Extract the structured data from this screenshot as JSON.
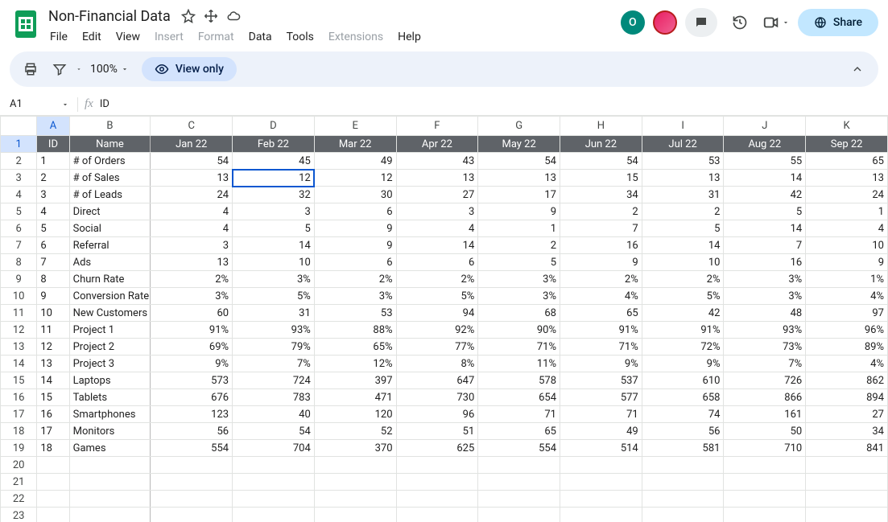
{
  "doc": {
    "title": "Non-Financial Data"
  },
  "menus": {
    "file": "File",
    "edit": "Edit",
    "view": "View",
    "insert": "Insert",
    "format": "Format",
    "data": "Data",
    "tools": "Tools",
    "extensions": "Extensions",
    "help": "Help"
  },
  "header": {
    "share": "Share",
    "avatar_letter": "O"
  },
  "toolbar": {
    "zoom": "100%",
    "viewonly": "View only"
  },
  "formula": {
    "name": "A1",
    "value": "ID"
  },
  "columns": [
    "A",
    "B",
    "C",
    "D",
    "E",
    "F",
    "G",
    "H",
    "I",
    "J",
    "K"
  ],
  "row_numbers": [
    "1",
    "2",
    "3",
    "4",
    "5",
    "6",
    "7",
    "8",
    "9",
    "10",
    "11",
    "12",
    "13",
    "14",
    "15",
    "16",
    "17",
    "18",
    "19",
    "20",
    "21",
    "22",
    "23"
  ],
  "header_row": [
    "ID",
    "Name",
    "Jan 22",
    "Feb 22",
    "Mar 22",
    "Apr 22",
    "May 22",
    "Jun 22",
    "Jul 22",
    "Aug 22",
    "Sep 22"
  ],
  "rows": [
    {
      "id": "1",
      "name": "# of Orders",
      "v": [
        "54",
        "45",
        "49",
        "43",
        "54",
        "54",
        "53",
        "55",
        "65"
      ]
    },
    {
      "id": "2",
      "name": "# of Sales",
      "v": [
        "13",
        "12",
        "12",
        "13",
        "13",
        "15",
        "13",
        "14",
        "13"
      ]
    },
    {
      "id": "3",
      "name": "# of Leads",
      "v": [
        "24",
        "32",
        "30",
        "27",
        "17",
        "34",
        "31",
        "42",
        "24"
      ]
    },
    {
      "id": "4",
      "name": "Direct",
      "v": [
        "4",
        "3",
        "6",
        "3",
        "9",
        "2",
        "2",
        "5",
        "1"
      ]
    },
    {
      "id": "5",
      "name": "Social",
      "v": [
        "4",
        "5",
        "9",
        "4",
        "1",
        "7",
        "5",
        "14",
        "4"
      ]
    },
    {
      "id": "6",
      "name": "Referral",
      "v": [
        "3",
        "14",
        "9",
        "14",
        "2",
        "16",
        "14",
        "7",
        "10"
      ]
    },
    {
      "id": "7",
      "name": "Ads",
      "v": [
        "13",
        "10",
        "6",
        "6",
        "5",
        "9",
        "10",
        "16",
        "9"
      ]
    },
    {
      "id": "8",
      "name": "Churn Rate",
      "v": [
        "2%",
        "3%",
        "2%",
        "2%",
        "3%",
        "2%",
        "2%",
        "3%",
        "1%"
      ]
    },
    {
      "id": "9",
      "name": "Conversion Rate",
      "v": [
        "3%",
        "5%",
        "3%",
        "5%",
        "3%",
        "4%",
        "5%",
        "3%",
        "4%"
      ]
    },
    {
      "id": "10",
      "name": "New Customers",
      "v": [
        "60",
        "31",
        "53",
        "94",
        "68",
        "65",
        "42",
        "48",
        "97"
      ]
    },
    {
      "id": "11",
      "name": "Project 1",
      "v": [
        "91%",
        "93%",
        "88%",
        "92%",
        "90%",
        "91%",
        "91%",
        "93%",
        "96%"
      ]
    },
    {
      "id": "12",
      "name": "Project 2",
      "v": [
        "69%",
        "79%",
        "65%",
        "77%",
        "71%",
        "71%",
        "72%",
        "73%",
        "89%"
      ]
    },
    {
      "id": "13",
      "name": "Project 3",
      "v": [
        "9%",
        "7%",
        "12%",
        "8%",
        "11%",
        "9%",
        "9%",
        "7%",
        "4%"
      ]
    },
    {
      "id": "14",
      "name": "Laptops",
      "v": [
        "573",
        "724",
        "397",
        "647",
        "578",
        "537",
        "610",
        "726",
        "862"
      ]
    },
    {
      "id": "15",
      "name": "Tablets",
      "v": [
        "676",
        "783",
        "471",
        "730",
        "654",
        "577",
        "658",
        "866",
        "894"
      ]
    },
    {
      "id": "16",
      "name": "Smartphones",
      "v": [
        "123",
        "40",
        "120",
        "96",
        "71",
        "71",
        "74",
        "161",
        "27"
      ]
    },
    {
      "id": "17",
      "name": "Monitors",
      "v": [
        "56",
        "54",
        "52",
        "51",
        "65",
        "49",
        "56",
        "50",
        "34"
      ]
    },
    {
      "id": "18",
      "name": "Games",
      "v": [
        "554",
        "704",
        "370",
        "625",
        "554",
        "514",
        "581",
        "710",
        "841"
      ]
    }
  ],
  "selected_cell": {
    "row": 2,
    "col": 3
  }
}
